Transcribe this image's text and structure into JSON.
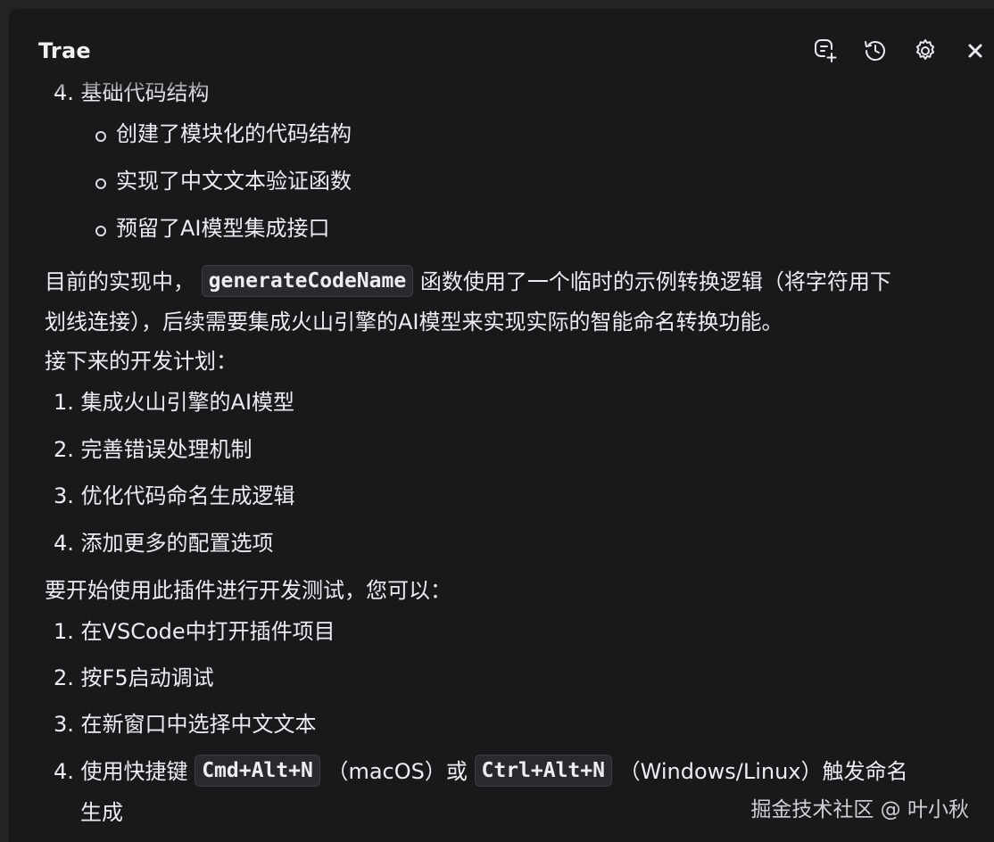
{
  "header": {
    "title": "Trae"
  },
  "icons": {
    "new_chat": "new-chat-icon",
    "history": "history-icon",
    "settings": "gear-icon",
    "close": "close-icon"
  },
  "content": {
    "cut_item": {
      "num": "4.",
      "text": "基础代码结构"
    },
    "sub_bullets": [
      "创建了模块化的代码结构",
      "实现了中文文本验证函数",
      "预留了AI模型集成接口"
    ],
    "para1": {
      "before": "目前的实现中，",
      "code": "generateCodeName",
      "after": "函数使用了一个临时的示例转换逻辑（将字符用下",
      "line2": "划线连接），后续需要集成火山引擎的AI模型来实现实际的智能命名转换功能。"
    },
    "plan_heading": "接下来的开发计划：",
    "plan_items": [
      {
        "num": "1.",
        "text": "集成火山引擎的AI模型"
      },
      {
        "num": "2.",
        "text": "完善错误处理机制"
      },
      {
        "num": "3.",
        "text": "优化代码命名生成逻辑"
      },
      {
        "num": "4.",
        "text": "添加更多的配置选项"
      }
    ],
    "test_heading": "要开始使用此插件进行开发测试，您可以：",
    "test_items": [
      {
        "num": "1.",
        "text": "在VSCode中打开插件项目"
      },
      {
        "num": "2.",
        "text": "按F5启动调试"
      },
      {
        "num": "3.",
        "text": "在新窗口中选择中文文本"
      }
    ],
    "last_item": {
      "num": "4.",
      "before": "使用快捷键",
      "code1": "Cmd+Alt+N",
      "middle": "（macOS）或",
      "code2": "Ctrl+Alt+N",
      "after": "（Windows/Linux）触发命名",
      "line2": "生成"
    }
  },
  "watermark": "掘金技术社区 @ 叶小秋"
}
